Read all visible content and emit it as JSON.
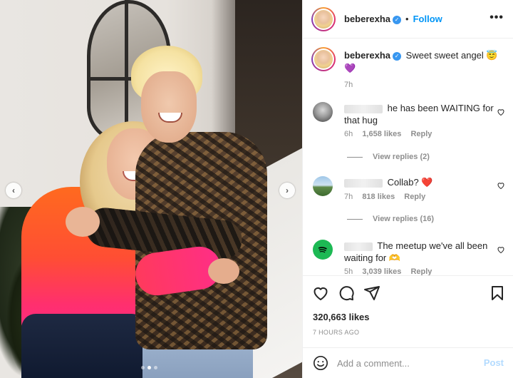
{
  "post": {
    "author": "beberexha",
    "follow_separator": "•",
    "follow_label": "Follow",
    "more_label": "•••",
    "caption_text": "Sweet sweet angel 😇",
    "caption_extra": "💜",
    "caption_time": "7h",
    "likes": "320,663 likes",
    "time_ago": "7 HOURS AGO",
    "carousel": {
      "count": 3,
      "active_index": 1
    }
  },
  "comments": [
    {
      "text": "he has been WAITING for that hug",
      "time": "6h",
      "likes": "1,658 likes",
      "reply_label": "Reply",
      "view_replies": "View replies (2)"
    },
    {
      "text": "Collab? ❤️",
      "time": "7h",
      "likes": "818 likes",
      "reply_label": "Reply",
      "view_replies": "View replies (16)"
    },
    {
      "text": "The meetup we've all been waiting for 🫶",
      "time": "5h",
      "likes": "3,039 likes",
      "reply_label": "Reply"
    }
  ],
  "add_comment": {
    "placeholder": "Add a comment...",
    "post_label": "Post"
  },
  "icons": {
    "prev": "chevron-left-icon",
    "next": "chevron-right-icon",
    "like": "heart-icon",
    "comment": "comment-icon",
    "share": "share-icon",
    "save": "bookmark-icon",
    "emoji": "emoji-icon",
    "verified": "verified-badge-icon"
  },
  "colors": {
    "accent": "#0095f6",
    "verified": "#3897f0",
    "muted": "#8e8e8e",
    "post_disabled": "#b3dbff",
    "heart_red": "#ed4956",
    "spotify_green": "#1db954"
  }
}
